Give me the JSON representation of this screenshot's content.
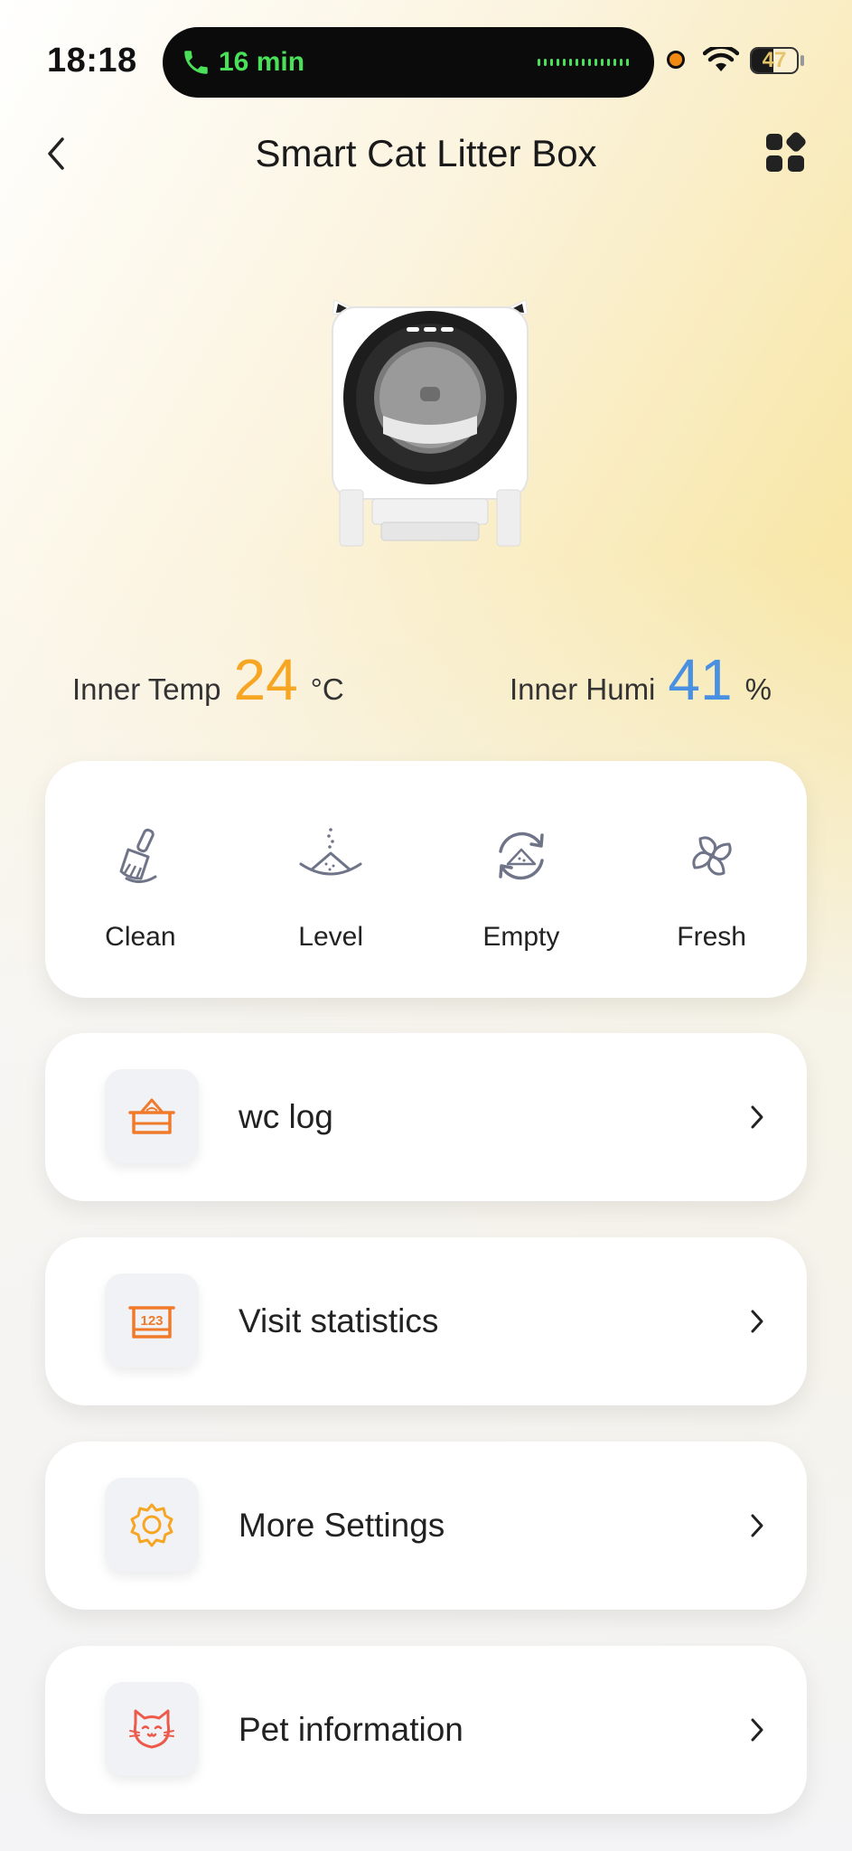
{
  "status_bar": {
    "time": "18:18",
    "call_duration": "16 min",
    "battery": "47",
    "battery_level": 0.47,
    "call_color": "#4be05a",
    "recording_indicator_color": "#f08a12"
  },
  "header": {
    "title": "Smart Cat Litter Box",
    "back_icon": "chevron-left-icon",
    "menu_icon": "grid-icon"
  },
  "sensors": {
    "temp": {
      "label": "Inner Temp",
      "value": "24",
      "unit": "°C",
      "color": "#f6a623"
    },
    "humi": {
      "label": "Inner Humi",
      "value": "41",
      "unit": "%",
      "color": "#4a90e2"
    }
  },
  "actions": [
    {
      "label": "Clean",
      "icon": "broom-icon"
    },
    {
      "label": "Level",
      "icon": "level-icon"
    },
    {
      "label": "Empty",
      "icon": "empty-cycle-icon"
    },
    {
      "label": "Fresh",
      "icon": "fan-icon"
    }
  ],
  "menu_items": [
    {
      "label": "wc log",
      "icon": "litter-tray-icon"
    },
    {
      "label": "Visit statistics",
      "icon": "statistics-tray-icon",
      "icon_text": "123"
    },
    {
      "label": "More Settings",
      "icon": "settings-gear-icon"
    },
    {
      "label": "Pet information",
      "icon": "cat-face-icon"
    }
  ]
}
